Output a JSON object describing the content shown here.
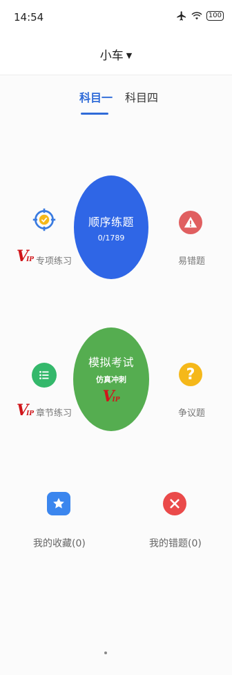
{
  "status_bar": {
    "time": "14:54",
    "battery": "100"
  },
  "header": {
    "title": "小车"
  },
  "tabs": [
    {
      "label": "科目一",
      "active": true
    },
    {
      "label": "科目四",
      "active": false
    }
  ],
  "main": {
    "sequential": {
      "title": "顺序练题",
      "progress": "0/1789"
    },
    "exam": {
      "title": "模拟考试",
      "subtitle": "仿真冲刺"
    },
    "topic": {
      "label": "专项练习"
    },
    "error_prone": {
      "label": "易错题"
    },
    "chapter": {
      "label": "章节练习"
    },
    "controversial": {
      "label": "争议题"
    },
    "favorites": {
      "label": "我的收藏(0)"
    },
    "mistakes": {
      "label": "我的错题(0)"
    },
    "vip_badge": "VIP"
  },
  "colors": {
    "accent": "#2f6bd8",
    "blue_circle": "#2f66e6",
    "green_circle": "#55ad50",
    "red_icon": "#e05f60",
    "yellow_icon": "#f5b81a",
    "green_icon": "#34b86b",
    "vip_red": "#d0161b"
  }
}
